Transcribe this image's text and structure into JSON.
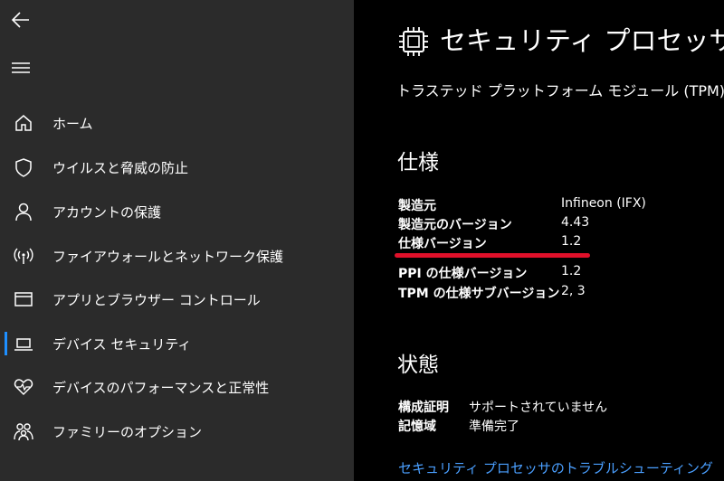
{
  "sidebar": {
    "items": [
      {
        "label": "ホーム",
        "icon": "home-icon"
      },
      {
        "label": "ウイルスと脅威の防止",
        "icon": "shield-icon"
      },
      {
        "label": "アカウントの保護",
        "icon": "person-icon"
      },
      {
        "label": "ファイアウォールとネットワーク保護",
        "icon": "wifi-signal-icon"
      },
      {
        "label": "アプリとブラウザー コントロール",
        "icon": "browser-window-icon"
      },
      {
        "label": "デバイス セキュリティ",
        "icon": "laptop-icon"
      },
      {
        "label": "デバイスのパフォーマンスと正常性",
        "icon": "heart-pulse-icon"
      },
      {
        "label": "ファミリーのオプション",
        "icon": "family-icon"
      }
    ],
    "active_index": 5
  },
  "main": {
    "title": "セキュリティ プロセッサの",
    "subtitle": "トラステッド プラットフォーム モジュール (TPM) に関す",
    "spec_heading": "仕様",
    "spec_rows": [
      {
        "key": "製造元",
        "value": "Infineon (IFX)"
      },
      {
        "key": "製造元のバージョン",
        "value": "4.43"
      },
      {
        "key": "仕様バージョン",
        "value": "1.2"
      },
      {
        "key": "PPI の仕様バージョン",
        "value": "1.2"
      },
      {
        "key": "TPM の仕様サブバージョン",
        "value": "2, 3"
      }
    ],
    "status_heading": "状態",
    "status_rows": [
      {
        "key": "構成証明",
        "value": "サポートされていません"
      },
      {
        "key": "記憶域",
        "value": "準備完了"
      }
    ],
    "troubleshoot_link": "セキュリティ プロセッサのトラブルシューティング"
  },
  "colors": {
    "sidebar_bg": "#2b2b2b",
    "main_bg": "#000000",
    "accent": "#1e8fff",
    "highlight": "#e0102a",
    "link": "#4a9fff"
  }
}
